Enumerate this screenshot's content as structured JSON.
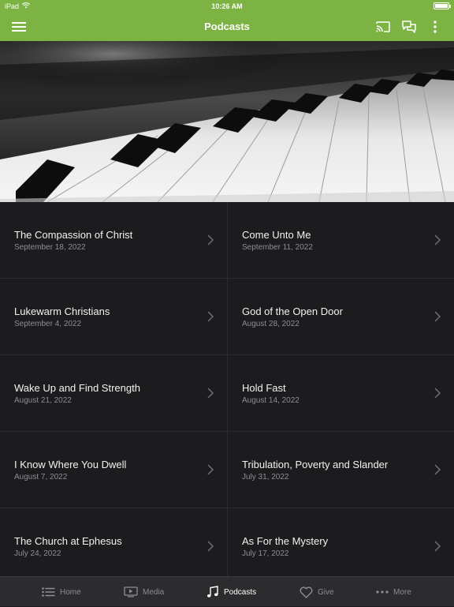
{
  "status": {
    "device": "iPad",
    "time": "10:26 AM"
  },
  "header": {
    "title": "Podcasts",
    "icons": [
      "menu-icon",
      "cast-icon",
      "chat-icon",
      "more-vertical-icon"
    ]
  },
  "hero": {
    "image": "piano-keys-photo"
  },
  "episodes": [
    {
      "title": "The Compassion of Christ",
      "date": "September 18, 2022"
    },
    {
      "title": "Come Unto Me",
      "date": "September 11, 2022"
    },
    {
      "title": "Lukewarm Christians",
      "date": "September 4, 2022"
    },
    {
      "title": "God of the Open Door",
      "date": "August 28, 2022"
    },
    {
      "title": "Wake Up and Find Strength",
      "date": "August 21, 2022"
    },
    {
      "title": "Hold Fast",
      "date": "August 14, 2022"
    },
    {
      "title": "I Know Where You Dwell",
      "date": "August 7, 2022"
    },
    {
      "title": "Tribulation, Poverty and Slander",
      "date": "July 31, 2022"
    },
    {
      "title": "The Church at Ephesus",
      "date": "July 24, 2022"
    },
    {
      "title": "As For the Mystery",
      "date": "July 17, 2022"
    }
  ],
  "tabs": [
    {
      "label": "Home",
      "icon": "list-icon"
    },
    {
      "label": "Media",
      "icon": "video-icon"
    },
    {
      "label": "Podcasts",
      "icon": "music-note-icon",
      "active": true
    },
    {
      "label": "Give",
      "icon": "heart-icon"
    },
    {
      "label": "More",
      "icon": "ellipsis-icon"
    }
  ],
  "colors": {
    "accent": "#7cb342",
    "background": "#1c1c1e",
    "tabbar": "#2c2c2e"
  }
}
